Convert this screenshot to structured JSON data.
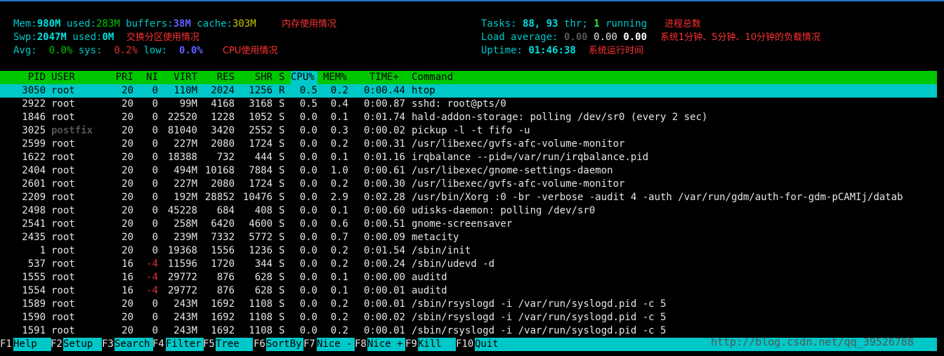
{
  "meters": {
    "mem": {
      "label": "Mem:",
      "total": "980M",
      "used_label": "used:",
      "used": "283M",
      "buffers_label": "buffers:",
      "buffers": "38M",
      "cache_label": "cache:",
      "cache": "303M",
      "note": "内存使用情况"
    },
    "swp": {
      "label": "Swp:",
      "total": "2047M",
      "used_label": "used:",
      "used": "0M",
      "note": "交换分区使用情况"
    },
    "avg": {
      "label": "Avg:",
      "user": "0.0%",
      "sys_label": "sys:",
      "sys": "0.2%",
      "low_label": "low:",
      "low": "0.0%",
      "note": "CPU使用情况"
    },
    "tasks": {
      "label": "Tasks:",
      "count": "88,",
      "threads": "93",
      "thr_label": "thr;",
      "running": "1",
      "running_label": "running",
      "note": "进程总数"
    },
    "load": {
      "label": "Load average:",
      "l1": "0.00",
      "l5": "0.00",
      "l15": "0.00",
      "note": "系统1分钟、5分钟、10分钟的负载情况"
    },
    "uptime": {
      "label": "Uptime:",
      "value": "01:46:38",
      "note": "系统运行时间"
    }
  },
  "columns": {
    "pid": "PID",
    "user": "USER",
    "pri": "PRI",
    "ni": "NI",
    "virt": "VIRT",
    "res": "RES",
    "shr": "SHR",
    "s": "S",
    "cpu": "CPU%",
    "mem": "MEM%",
    "time": "TIME+",
    "cmd": "Command"
  },
  "processes": [
    {
      "pid": "3050",
      "user": "root",
      "pri": "20",
      "ni": "0",
      "virt": "110M",
      "res": "2024",
      "shr": "1256",
      "s": "R",
      "cpu": "0.5",
      "mem": "0.2",
      "time": "0:00.44",
      "cmd": "htop",
      "selected": true
    },
    {
      "pid": "2922",
      "user": "root",
      "pri": "20",
      "ni": "0",
      "virt": "99M",
      "res": "4168",
      "shr": "3168",
      "s": "S",
      "cpu": "0.5",
      "mem": "0.4",
      "time": "0:00.87",
      "cmd": "sshd: root@pts/0"
    },
    {
      "pid": "1846",
      "user": "root",
      "pri": "20",
      "ni": "0",
      "virt": "22520",
      "res": "1228",
      "shr": "1052",
      "s": "S",
      "cpu": "0.0",
      "mem": "0.1",
      "time": "0:01.74",
      "cmd": "hald-addon-storage: polling /dev/sr0 (every 2 sec)"
    },
    {
      "pid": "3025",
      "user": "postfix",
      "pri": "20",
      "ni": "0",
      "virt": "81040",
      "res": "3420",
      "shr": "2552",
      "s": "S",
      "cpu": "0.0",
      "mem": "0.3",
      "time": "0:00.02",
      "cmd": "pickup -l -t fifo -u"
    },
    {
      "pid": "2599",
      "user": "root",
      "pri": "20",
      "ni": "0",
      "virt": "227M",
      "res": "2080",
      "shr": "1724",
      "s": "S",
      "cpu": "0.0",
      "mem": "0.2",
      "time": "0:00.31",
      "cmd": "/usr/libexec/gvfs-afc-volume-monitor"
    },
    {
      "pid": "1622",
      "user": "root",
      "pri": "20",
      "ni": "0",
      "virt": "18388",
      "res": "732",
      "shr": "444",
      "s": "S",
      "cpu": "0.0",
      "mem": "0.1",
      "time": "0:01.16",
      "cmd": "irqbalance --pid=/var/run/irqbalance.pid"
    },
    {
      "pid": "2404",
      "user": "root",
      "pri": "20",
      "ni": "0",
      "virt": "494M",
      "res": "10168",
      "shr": "7884",
      "s": "S",
      "cpu": "0.0",
      "mem": "1.0",
      "time": "0:00.61",
      "cmd": "/usr/libexec/gnome-settings-daemon"
    },
    {
      "pid": "2601",
      "user": "root",
      "pri": "20",
      "ni": "0",
      "virt": "227M",
      "res": "2080",
      "shr": "1724",
      "s": "S",
      "cpu": "0.0",
      "mem": "0.2",
      "time": "0:00.30",
      "cmd": "/usr/libexec/gvfs-afc-volume-monitor"
    },
    {
      "pid": "2209",
      "user": "root",
      "pri": "20",
      "ni": "0",
      "virt": "192M",
      "res": "28852",
      "shr": "10476",
      "s": "S",
      "cpu": "0.0",
      "mem": "2.9",
      "time": "0:02.28",
      "cmd": "/usr/bin/Xorg :0 -br -verbose -audit 4 -auth /var/run/gdm/auth-for-gdm-pCAMIj/datab"
    },
    {
      "pid": "2498",
      "user": "root",
      "pri": "20",
      "ni": "0",
      "virt": "45228",
      "res": "684",
      "shr": "408",
      "s": "S",
      "cpu": "0.0",
      "mem": "0.1",
      "time": "0:00.60",
      "cmd": "udisks-daemon: polling /dev/sr0"
    },
    {
      "pid": "2541",
      "user": "root",
      "pri": "20",
      "ni": "0",
      "virt": "258M",
      "res": "6420",
      "shr": "4600",
      "s": "S",
      "cpu": "0.0",
      "mem": "0.6",
      "time": "0:00.51",
      "cmd": "gnome-screensaver"
    },
    {
      "pid": "2435",
      "user": "root",
      "pri": "20",
      "ni": "0",
      "virt": "239M",
      "res": "7332",
      "shr": "5772",
      "s": "S",
      "cpu": "0.0",
      "mem": "0.7",
      "time": "0:00.09",
      "cmd": "metacity"
    },
    {
      "pid": "1",
      "user": "root",
      "pri": "20",
      "ni": "0",
      "virt": "19368",
      "res": "1556",
      "shr": "1236",
      "s": "S",
      "cpu": "0.0",
      "mem": "0.2",
      "time": "0:01.54",
      "cmd": "/sbin/init"
    },
    {
      "pid": "537",
      "user": "root",
      "pri": "16",
      "ni": "-4",
      "virt": "11596",
      "res": "1720",
      "shr": "344",
      "s": "S",
      "cpu": "0.0",
      "mem": "0.2",
      "time": "0:00.24",
      "cmd": "/sbin/udevd -d"
    },
    {
      "pid": "1555",
      "user": "root",
      "pri": "16",
      "ni": "-4",
      "virt": "29772",
      "res": "876",
      "shr": "628",
      "s": "S",
      "cpu": "0.0",
      "mem": "0.1",
      "time": "0:00.00",
      "cmd": "auditd"
    },
    {
      "pid": "1554",
      "user": "root",
      "pri": "16",
      "ni": "-4",
      "virt": "29772",
      "res": "876",
      "shr": "628",
      "s": "S",
      "cpu": "0.0",
      "mem": "0.1",
      "time": "0:00.01",
      "cmd": "auditd"
    },
    {
      "pid": "1589",
      "user": "root",
      "pri": "20",
      "ni": "0",
      "virt": "243M",
      "res": "1692",
      "shr": "1108",
      "s": "S",
      "cpu": "0.0",
      "mem": "0.2",
      "time": "0:00.01",
      "cmd": "/sbin/rsyslogd -i /var/run/syslogd.pid -c 5"
    },
    {
      "pid": "1590",
      "user": "root",
      "pri": "20",
      "ni": "0",
      "virt": "243M",
      "res": "1692",
      "shr": "1108",
      "s": "S",
      "cpu": "0.0",
      "mem": "0.2",
      "time": "0:00.02",
      "cmd": "/sbin/rsyslogd -i /var/run/syslogd.pid -c 5"
    },
    {
      "pid": "1591",
      "user": "root",
      "pri": "20",
      "ni": "0",
      "virt": "243M",
      "res": "1692",
      "shr": "1108",
      "s": "S",
      "cpu": "0.0",
      "mem": "0.2",
      "time": "0:00.01",
      "cmd": "/sbin/rsyslogd -i /var/run/syslogd.pid -c 5"
    }
  ],
  "function_keys": [
    {
      "key": "F1",
      "label": "Help"
    },
    {
      "key": "F2",
      "label": "Setup"
    },
    {
      "key": "F3",
      "label": "Search"
    },
    {
      "key": "F4",
      "label": "Filter"
    },
    {
      "key": "F5",
      "label": "Tree"
    },
    {
      "key": "F6",
      "label": "SortBy"
    },
    {
      "key": "F7",
      "label": "Nice -"
    },
    {
      "key": "F8",
      "label": "Nice +"
    },
    {
      "key": "F9",
      "label": "Kill"
    },
    {
      "key": "F10",
      "label": "Quit"
    }
  ],
  "watermark": "http://blog.csdn.net/qq_39526788"
}
